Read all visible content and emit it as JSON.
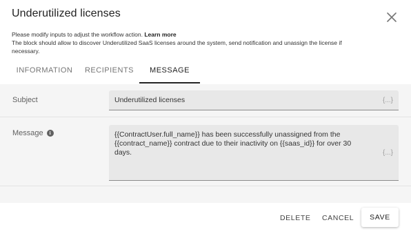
{
  "dialog": {
    "title": "Underutilized licenses",
    "description_line1": "Please modify inputs to adjust the workflow action.",
    "learn_more": "Learn more",
    "description_line2": "The block should allow to discover Underutilized SaaS licenses around the system, send notification and unassign the license if necessary."
  },
  "tabs": [
    {
      "label": "INFORMATION",
      "active": false
    },
    {
      "label": "RECIPIENTS",
      "active": false
    },
    {
      "label": "MESSAGE",
      "active": true
    }
  ],
  "form": {
    "subject": {
      "label": "Subject",
      "value": "Underutilized licenses",
      "var_button": "{...}"
    },
    "message": {
      "label": "Message",
      "info_icon": "i",
      "value": "{{ContractUser.full_name}} has been successfully unassigned from the {{contract_name}} contract due to their inactivity on {{saas_id}} for over 30 days.",
      "var_button": "{...}"
    }
  },
  "footer": {
    "delete_label": "DELETE",
    "cancel_label": "CANCEL",
    "save_label": "SAVE"
  },
  "icons": {
    "close": "close-icon",
    "info": "info-icon"
  }
}
